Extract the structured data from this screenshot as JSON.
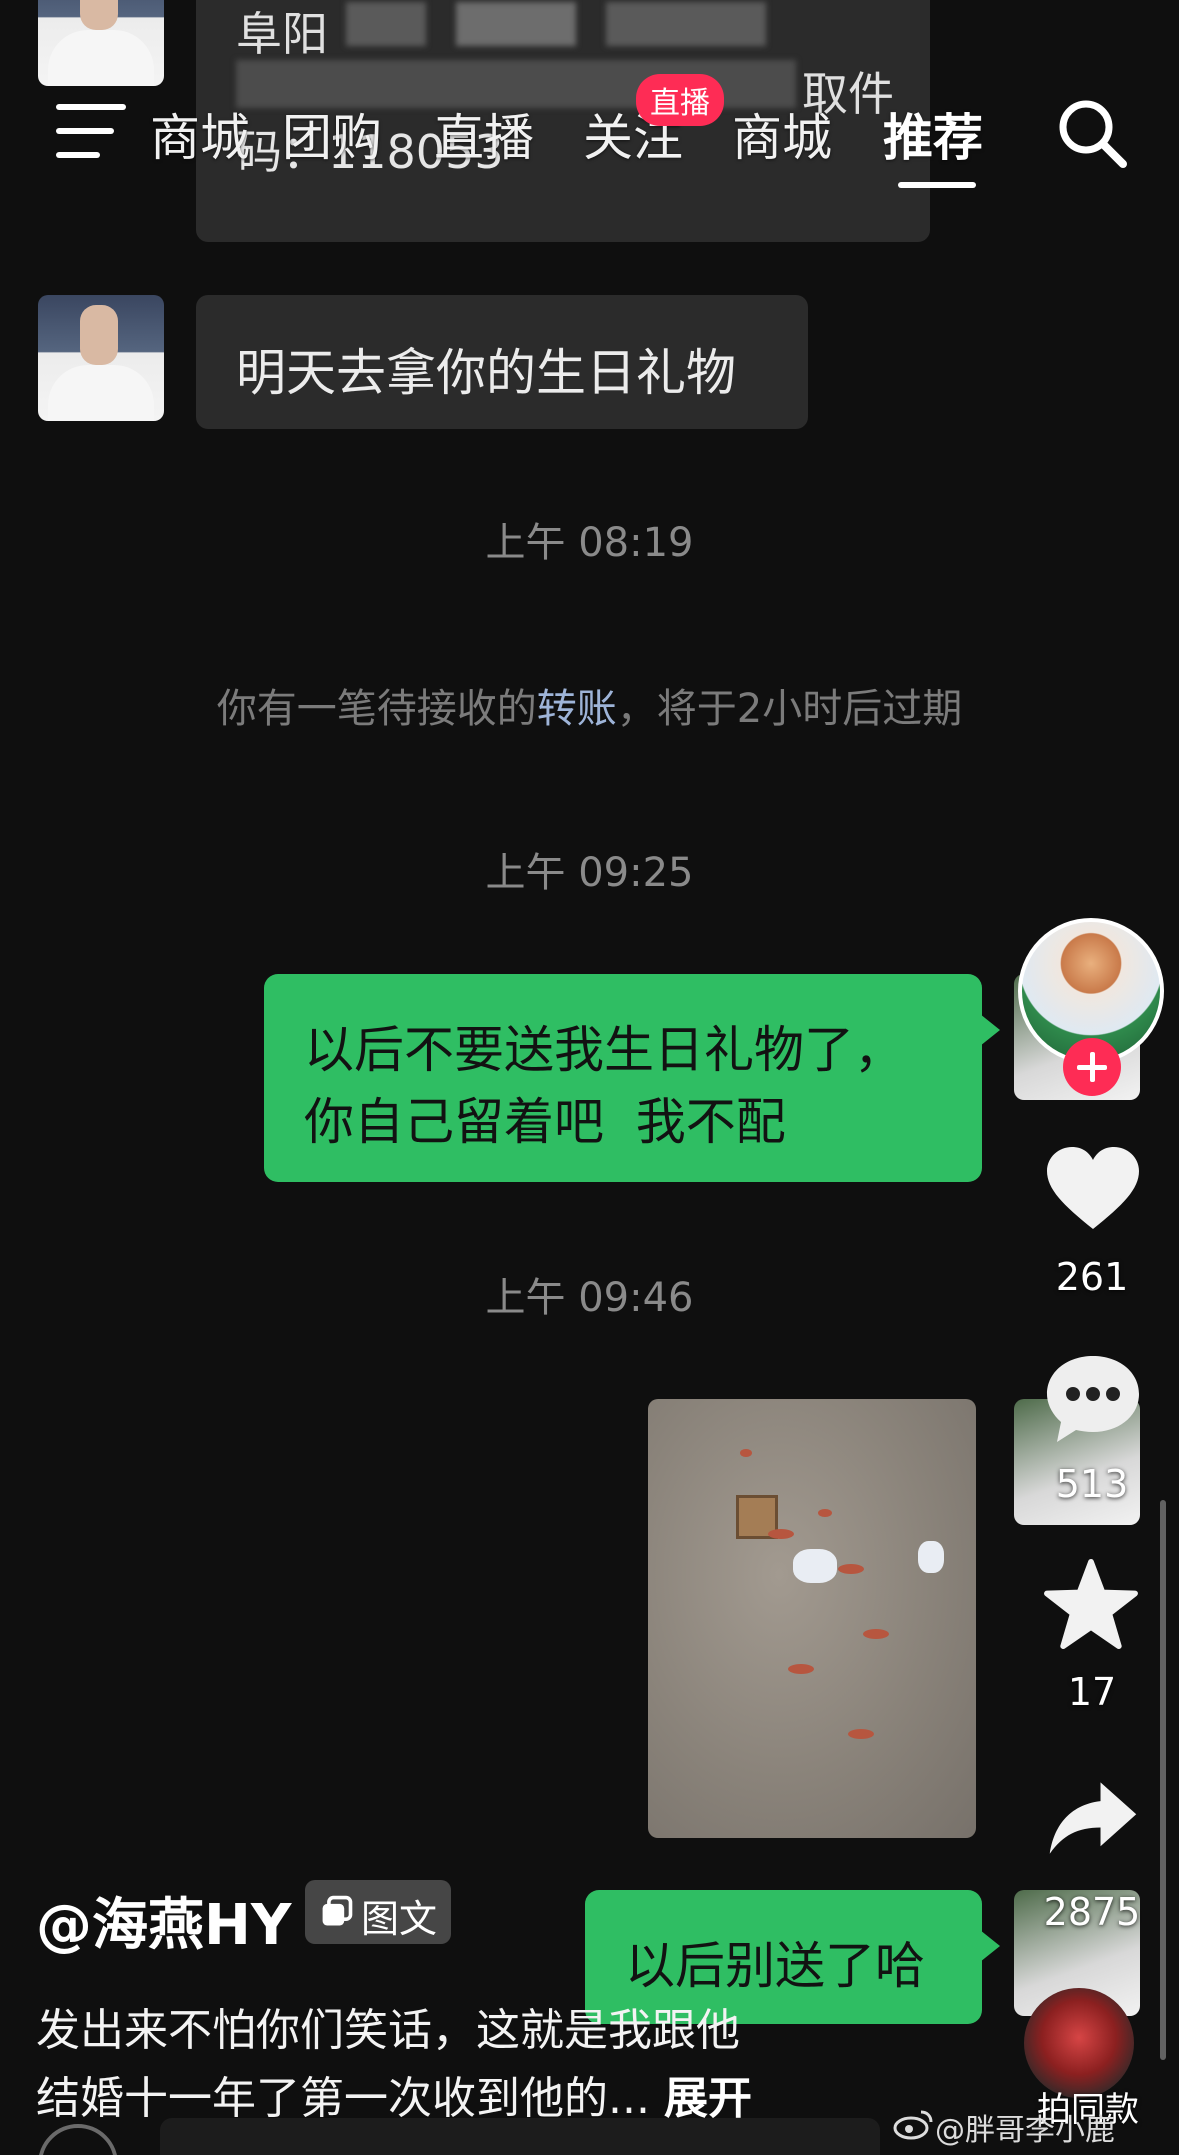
{
  "chat": {
    "redacted_text": {
      "line1": "阜阳",
      "line2_suffix": "取件",
      "pickup_code_line": "码：118053"
    },
    "msg_birthday_gift": "明天去拿你的生日礼物",
    "time_1": "上午 08:19",
    "transfer_note": {
      "prefix": "你有一笔待接收的",
      "link": "转账",
      "suffix": "，将于2小时后过期"
    },
    "time_2": "上午 09:25",
    "msg_reply_line1": "以后不要送我生日礼物了，",
    "msg_reply_line2": "你自己留着吧  我不配",
    "time_3": "上午 09:46",
    "msg_last": "以后别送了哈"
  },
  "top_nav": {
    "tabs": [
      "商城",
      "团购",
      "直播",
      "关注",
      "商城",
      "推荐"
    ],
    "active_tab": "推荐",
    "live_badge": "直播",
    "menu_icon": "menu-icon",
    "search_icon": "search-icon"
  },
  "right_rail": {
    "like_count": "261",
    "comment_count": "513",
    "favorite_count": "17",
    "share_count": "2875",
    "same_style_label": "拍同款",
    "icons": [
      "follow-plus-icon",
      "heart-icon",
      "comment-icon",
      "star-icon",
      "share-icon"
    ]
  },
  "post": {
    "author": "@海燕HY",
    "type_tag": "图文",
    "desc_line1": "发出来不怕你们笑话，这就是我跟他",
    "desc_line2": "结婚十一年了第一次收到他的...",
    "expand": "展开"
  },
  "watermark": "@胖哥李小鹿",
  "colors": {
    "background": "#0f0f0f",
    "green_bubble": "#2fbe63",
    "gray_bubble": "#2b2b2b",
    "live_badge": "#fe2c55"
  }
}
